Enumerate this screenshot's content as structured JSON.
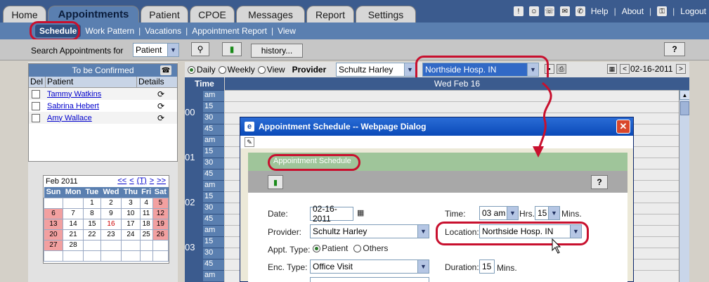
{
  "tabs": [
    {
      "label": "Home",
      "active": false
    },
    {
      "label": "Appointments",
      "active": true
    },
    {
      "label": "Patient",
      "active": false
    },
    {
      "label": "CPOE",
      "active": false
    },
    {
      "label": "Messages",
      "active": false
    },
    {
      "label": "Report",
      "active": false
    },
    {
      "label": "Settings",
      "active": false
    }
  ],
  "top_links": {
    "help": "Help",
    "about": "About",
    "logout": "Logout"
  },
  "subnav": [
    "Schedule",
    "Work Pattern",
    "Vacations",
    "Appointment Report",
    "View"
  ],
  "search": {
    "label": "Search Appointments for",
    "selected": "Patient",
    "history_label": "history...",
    "help_label": "?"
  },
  "to_be_confirmed": {
    "title": "To be Confirmed",
    "columns": [
      "Del",
      "Patient",
      "Details"
    ],
    "patients": [
      "Tammy Watkins",
      "Sabrina Hebert",
      "Amy Wallace"
    ]
  },
  "calendar": {
    "month": "Feb 2011",
    "nav": [
      "<<",
      "<",
      "(T)",
      ">",
      ">>"
    ],
    "weekdays": [
      "Sun",
      "Mon",
      "Tue",
      "Wed",
      "Thu",
      "Fri",
      "Sat"
    ],
    "weeks": [
      [
        "",
        "",
        "1",
        "2",
        "3",
        "4",
        "5"
      ],
      [
        "6",
        "7",
        "8",
        "9",
        "10",
        "11",
        "12"
      ],
      [
        "13",
        "14",
        "15",
        "16",
        "17",
        "18",
        "19"
      ],
      [
        "20",
        "21",
        "22",
        "23",
        "24",
        "25",
        "26"
      ],
      [
        "27",
        "28",
        "",
        "",
        "",
        "",
        ""
      ],
      [
        "",
        "",
        "",
        "",
        "",
        "",
        ""
      ]
    ]
  },
  "view": {
    "options": [
      "Daily",
      "Weekly",
      "View"
    ],
    "selected": "Daily",
    "provider_label": "Provider",
    "provider": "Schultz Harley",
    "location": "Northside Hosp. IN",
    "date": "02-16-2011",
    "prev": "<",
    "next": ">"
  },
  "schedule": {
    "time_header": "Time",
    "day_header": "Wed Feb 16",
    "hours": [
      {
        "hour": "00",
        "slots": [
          "am",
          "15",
          "30",
          "45"
        ]
      },
      {
        "hour": "01",
        "slots": [
          "am",
          "15",
          "30",
          "45"
        ]
      },
      {
        "hour": "02",
        "slots": [
          "am",
          "15",
          "30",
          "45"
        ]
      },
      {
        "hour": "03",
        "slots": [
          "am",
          "15",
          "30",
          "45"
        ]
      },
      {
        "hour": "",
        "slots": [
          "am"
        ]
      }
    ]
  },
  "dialog": {
    "title": "Appointment Schedule -- Webpage Dialog",
    "section": "Appointment Schedule",
    "help_label": "?",
    "date_label": "Date:",
    "date_value": "02-16-2011",
    "time_label": "Time:",
    "time_hrs": "03 am",
    "hrs_label": "Hrs.",
    "time_mins": "15",
    "mins_label": "Mins.",
    "provider_label": "Provider:",
    "provider_value": "Schultz Harley",
    "location_label": "Location:",
    "location_value": "Northside Hosp. IN",
    "appt_type_label": "Appt. Type:",
    "appt_patient": "Patient",
    "appt_others": "Others",
    "enc_type_label": "Enc. Type:",
    "enc_type_value": "Office Visit",
    "duration_label": "Duration:",
    "duration_value": "15",
    "duration_unit": "Mins."
  },
  "colors": {
    "highlight": "#c8102e",
    "nav_blue": "#3b5b8e",
    "weekend": "#f2a0a0"
  }
}
